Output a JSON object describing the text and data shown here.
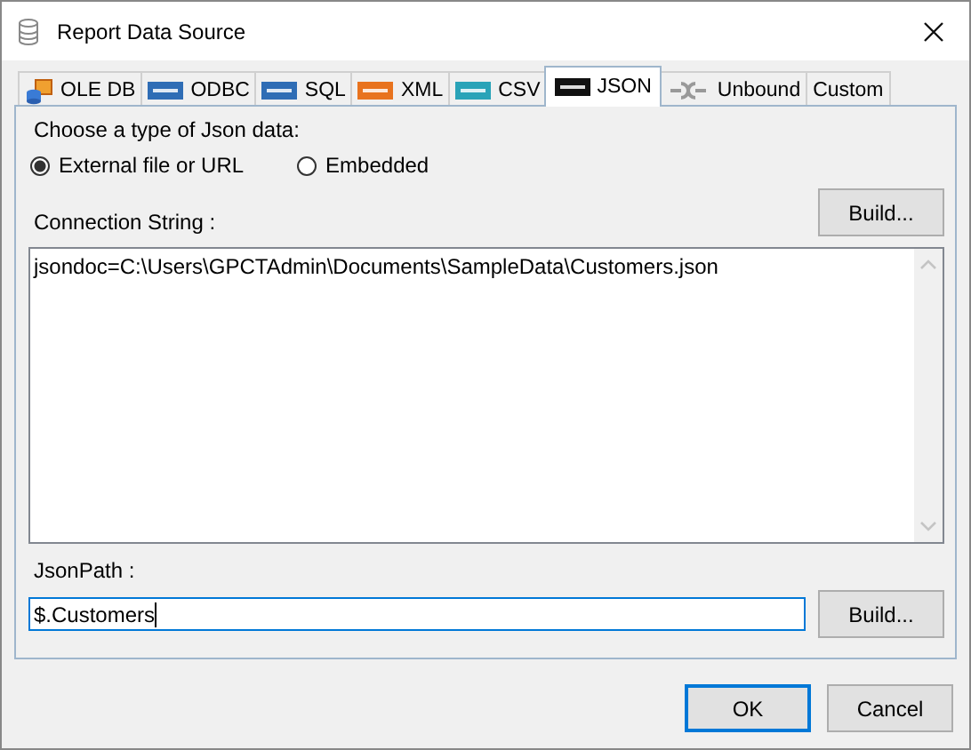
{
  "window": {
    "title": "Report Data Source"
  },
  "tabs": [
    {
      "label": "OLE DB",
      "kind": "oledb",
      "selected": false
    },
    {
      "label": "ODBC",
      "kind": "badge",
      "color": "#2f6db5",
      "selected": false
    },
    {
      "label": "SQL",
      "kind": "badge",
      "color": "#2f6db5",
      "selected": false
    },
    {
      "label": "XML",
      "kind": "badge",
      "color": "#e8731e",
      "selected": false
    },
    {
      "label": "CSV",
      "kind": "badge",
      "color": "#2aa3b8",
      "selected": false
    },
    {
      "label": "JSON",
      "kind": "badge",
      "color": "#111111",
      "selected": true
    },
    {
      "label": "Unbound",
      "kind": "unbound",
      "selected": false
    },
    {
      "label": "Custom",
      "kind": "none",
      "selected": false
    }
  ],
  "json_type": {
    "label": "Choose a type of Json data:",
    "options": [
      {
        "label": "External file or URL",
        "selected": true
      },
      {
        "label": "Embedded",
        "selected": false
      }
    ]
  },
  "connection": {
    "label": "Connection String :",
    "build": "Build...",
    "value": "jsondoc=C:\\Users\\GPCTAdmin\\Documents\\SampleData\\Customers.json"
  },
  "json_path": {
    "label": "JsonPath :",
    "value": "$.Customers",
    "focused": true,
    "build": "Build..."
  },
  "buttons": [
    {
      "label": "OK",
      "default": true
    },
    {
      "label": "Cancel",
      "default": false
    }
  ]
}
